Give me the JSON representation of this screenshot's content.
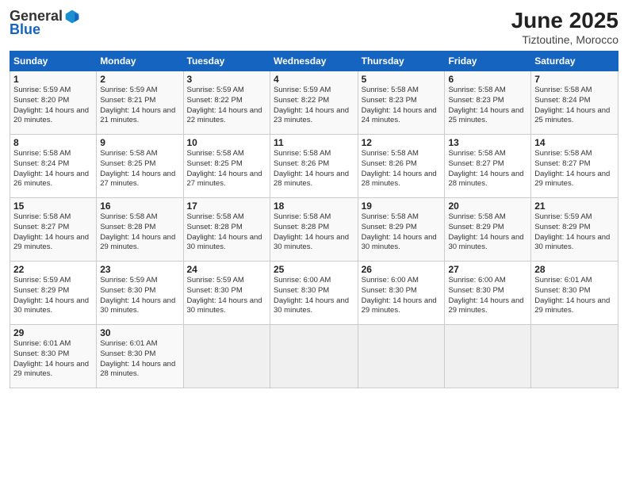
{
  "header": {
    "logo_general": "General",
    "logo_blue": "Blue",
    "title": "June 2025",
    "location": "Tiztoutine, Morocco"
  },
  "weekdays": [
    "Sunday",
    "Monday",
    "Tuesday",
    "Wednesday",
    "Thursday",
    "Friday",
    "Saturday"
  ],
  "weeks": [
    [
      {
        "day": "1",
        "sunrise": "Sunrise: 5:59 AM",
        "sunset": "Sunset: 8:20 PM",
        "daylight": "Daylight: 14 hours and 20 minutes."
      },
      {
        "day": "2",
        "sunrise": "Sunrise: 5:59 AM",
        "sunset": "Sunset: 8:21 PM",
        "daylight": "Daylight: 14 hours and 21 minutes."
      },
      {
        "day": "3",
        "sunrise": "Sunrise: 5:59 AM",
        "sunset": "Sunset: 8:22 PM",
        "daylight": "Daylight: 14 hours and 22 minutes."
      },
      {
        "day": "4",
        "sunrise": "Sunrise: 5:59 AM",
        "sunset": "Sunset: 8:22 PM",
        "daylight": "Daylight: 14 hours and 23 minutes."
      },
      {
        "day": "5",
        "sunrise": "Sunrise: 5:58 AM",
        "sunset": "Sunset: 8:23 PM",
        "daylight": "Daylight: 14 hours and 24 minutes."
      },
      {
        "day": "6",
        "sunrise": "Sunrise: 5:58 AM",
        "sunset": "Sunset: 8:23 PM",
        "daylight": "Daylight: 14 hours and 25 minutes."
      },
      {
        "day": "7",
        "sunrise": "Sunrise: 5:58 AM",
        "sunset": "Sunset: 8:24 PM",
        "daylight": "Daylight: 14 hours and 25 minutes."
      }
    ],
    [
      {
        "day": "8",
        "sunrise": "Sunrise: 5:58 AM",
        "sunset": "Sunset: 8:24 PM",
        "daylight": "Daylight: 14 hours and 26 minutes."
      },
      {
        "day": "9",
        "sunrise": "Sunrise: 5:58 AM",
        "sunset": "Sunset: 8:25 PM",
        "daylight": "Daylight: 14 hours and 27 minutes."
      },
      {
        "day": "10",
        "sunrise": "Sunrise: 5:58 AM",
        "sunset": "Sunset: 8:25 PM",
        "daylight": "Daylight: 14 hours and 27 minutes."
      },
      {
        "day": "11",
        "sunrise": "Sunrise: 5:58 AM",
        "sunset": "Sunset: 8:26 PM",
        "daylight": "Daylight: 14 hours and 28 minutes."
      },
      {
        "day": "12",
        "sunrise": "Sunrise: 5:58 AM",
        "sunset": "Sunset: 8:26 PM",
        "daylight": "Daylight: 14 hours and 28 minutes."
      },
      {
        "day": "13",
        "sunrise": "Sunrise: 5:58 AM",
        "sunset": "Sunset: 8:27 PM",
        "daylight": "Daylight: 14 hours and 28 minutes."
      },
      {
        "day": "14",
        "sunrise": "Sunrise: 5:58 AM",
        "sunset": "Sunset: 8:27 PM",
        "daylight": "Daylight: 14 hours and 29 minutes."
      }
    ],
    [
      {
        "day": "15",
        "sunrise": "Sunrise: 5:58 AM",
        "sunset": "Sunset: 8:27 PM",
        "daylight": "Daylight: 14 hours and 29 minutes."
      },
      {
        "day": "16",
        "sunrise": "Sunrise: 5:58 AM",
        "sunset": "Sunset: 8:28 PM",
        "daylight": "Daylight: 14 hours and 29 minutes."
      },
      {
        "day": "17",
        "sunrise": "Sunrise: 5:58 AM",
        "sunset": "Sunset: 8:28 PM",
        "daylight": "Daylight: 14 hours and 30 minutes."
      },
      {
        "day": "18",
        "sunrise": "Sunrise: 5:58 AM",
        "sunset": "Sunset: 8:28 PM",
        "daylight": "Daylight: 14 hours and 30 minutes."
      },
      {
        "day": "19",
        "sunrise": "Sunrise: 5:58 AM",
        "sunset": "Sunset: 8:29 PM",
        "daylight": "Daylight: 14 hours and 30 minutes."
      },
      {
        "day": "20",
        "sunrise": "Sunrise: 5:58 AM",
        "sunset": "Sunset: 8:29 PM",
        "daylight": "Daylight: 14 hours and 30 minutes."
      },
      {
        "day": "21",
        "sunrise": "Sunrise: 5:59 AM",
        "sunset": "Sunset: 8:29 PM",
        "daylight": "Daylight: 14 hours and 30 minutes."
      }
    ],
    [
      {
        "day": "22",
        "sunrise": "Sunrise: 5:59 AM",
        "sunset": "Sunset: 8:29 PM",
        "daylight": "Daylight: 14 hours and 30 minutes."
      },
      {
        "day": "23",
        "sunrise": "Sunrise: 5:59 AM",
        "sunset": "Sunset: 8:30 PM",
        "daylight": "Daylight: 14 hours and 30 minutes."
      },
      {
        "day": "24",
        "sunrise": "Sunrise: 5:59 AM",
        "sunset": "Sunset: 8:30 PM",
        "daylight": "Daylight: 14 hours and 30 minutes."
      },
      {
        "day": "25",
        "sunrise": "Sunrise: 6:00 AM",
        "sunset": "Sunset: 8:30 PM",
        "daylight": "Daylight: 14 hours and 30 minutes."
      },
      {
        "day": "26",
        "sunrise": "Sunrise: 6:00 AM",
        "sunset": "Sunset: 8:30 PM",
        "daylight": "Daylight: 14 hours and 29 minutes."
      },
      {
        "day": "27",
        "sunrise": "Sunrise: 6:00 AM",
        "sunset": "Sunset: 8:30 PM",
        "daylight": "Daylight: 14 hours and 29 minutes."
      },
      {
        "day": "28",
        "sunrise": "Sunrise: 6:01 AM",
        "sunset": "Sunset: 8:30 PM",
        "daylight": "Daylight: 14 hours and 29 minutes."
      }
    ],
    [
      {
        "day": "29",
        "sunrise": "Sunrise: 6:01 AM",
        "sunset": "Sunset: 8:30 PM",
        "daylight": "Daylight: 14 hours and 29 minutes."
      },
      {
        "day": "30",
        "sunrise": "Sunrise: 6:01 AM",
        "sunset": "Sunset: 8:30 PM",
        "daylight": "Daylight: 14 hours and 28 minutes."
      },
      {
        "day": "",
        "sunrise": "",
        "sunset": "",
        "daylight": ""
      },
      {
        "day": "",
        "sunrise": "",
        "sunset": "",
        "daylight": ""
      },
      {
        "day": "",
        "sunrise": "",
        "sunset": "",
        "daylight": ""
      },
      {
        "day": "",
        "sunrise": "",
        "sunset": "",
        "daylight": ""
      },
      {
        "day": "",
        "sunrise": "",
        "sunset": "",
        "daylight": ""
      }
    ]
  ]
}
